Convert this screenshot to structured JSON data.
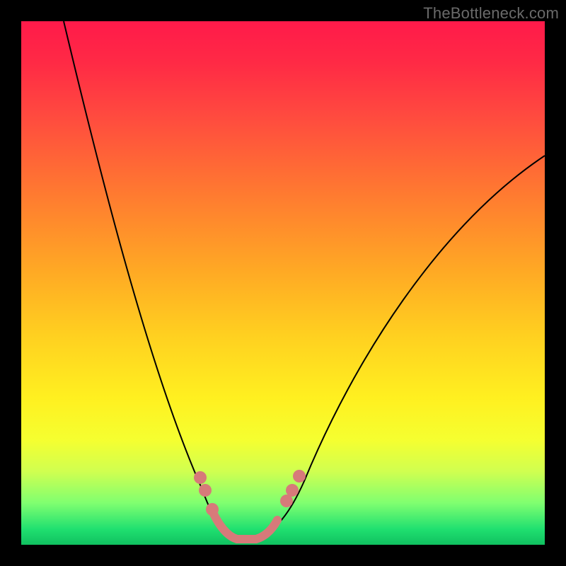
{
  "watermark": "TheBottleneck.com",
  "chart_data": {
    "type": "line",
    "title": "",
    "xlabel": "",
    "ylabel": "",
    "xlim": [
      0,
      100
    ],
    "ylim": [
      0,
      100
    ],
    "background_gradient": {
      "direction": "top-to-bottom",
      "stops": [
        {
          "pos": 0,
          "color": "#ff1a4a"
        },
        {
          "pos": 50,
          "color": "#ffaa24"
        },
        {
          "pos": 75,
          "color": "#fff020"
        },
        {
          "pos": 95,
          "color": "#40e070"
        },
        {
          "pos": 100,
          "color": "#10c060"
        }
      ]
    },
    "series": [
      {
        "name": "bottleneck-curve",
        "x": [
          8,
          14,
          20,
          26,
          32,
          36,
          40,
          43,
          46,
          50,
          54,
          60,
          70,
          85,
          100
        ],
        "y": [
          100,
          80,
          60,
          42,
          26,
          16,
          7,
          2,
          2,
          5,
          12,
          25,
          45,
          62,
          74
        ]
      }
    ],
    "markers": [
      {
        "x": 34,
        "y": 13,
        "color": "#d77a7a"
      },
      {
        "x": 35,
        "y": 10,
        "color": "#d77a7a"
      },
      {
        "x": 36.5,
        "y": 7,
        "color": "#d77a7a"
      },
      {
        "x": 50.5,
        "y": 8,
        "color": "#d77a7a"
      },
      {
        "x": 51.7,
        "y": 10,
        "color": "#d77a7a"
      },
      {
        "x": 53,
        "y": 13,
        "color": "#d77a7a"
      }
    ],
    "trough_highlight": {
      "color": "#d77a7a",
      "x_range": [
        36,
        49
      ],
      "y": 1
    }
  }
}
